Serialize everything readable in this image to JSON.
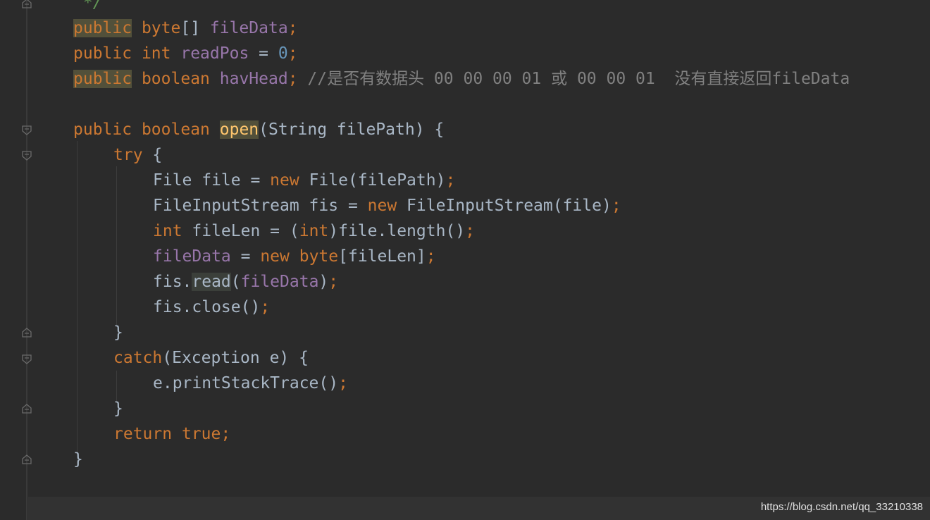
{
  "editor": {
    "lines": [
      {
        "tokens": [
          {
            "t": " */",
            "c": "doc"
          }
        ]
      },
      {
        "tokens": [
          {
            "t": "public",
            "c": "kw hl-kw"
          },
          {
            "t": " ",
            "c": "plain"
          },
          {
            "t": "byte",
            "c": "kw"
          },
          {
            "t": "[] ",
            "c": "plain"
          },
          {
            "t": "fileData",
            "c": "fld"
          },
          {
            "t": ";",
            "c": "semi"
          }
        ]
      },
      {
        "tokens": [
          {
            "t": "public",
            "c": "kw"
          },
          {
            "t": " ",
            "c": "plain"
          },
          {
            "t": "int",
            "c": "kw"
          },
          {
            "t": " ",
            "c": "plain"
          },
          {
            "t": "readPos",
            "c": "fld"
          },
          {
            "t": " = ",
            "c": "plain"
          },
          {
            "t": "0",
            "c": "num"
          },
          {
            "t": ";",
            "c": "semi"
          }
        ]
      },
      {
        "tokens": [
          {
            "t": "public",
            "c": "kw hl-kw"
          },
          {
            "t": " ",
            "c": "plain"
          },
          {
            "t": "boolean",
            "c": "kw"
          },
          {
            "t": " ",
            "c": "plain"
          },
          {
            "t": "havHead",
            "c": "fld"
          },
          {
            "t": "; ",
            "c": "semi"
          },
          {
            "t": "//是否有数据头 00 00 00 01 或 00 00 01  没有直接返回fileData",
            "c": "cmt"
          }
        ]
      },
      {
        "tokens": []
      },
      {
        "tokens": [
          {
            "t": "public",
            "c": "kw"
          },
          {
            "t": " ",
            "c": "plain"
          },
          {
            "t": "boolean",
            "c": "kw"
          },
          {
            "t": " ",
            "c": "plain"
          },
          {
            "t": "open",
            "c": "hl-yellow"
          },
          {
            "t": "(String filePath) {",
            "c": "plain"
          }
        ]
      },
      {
        "tokens": [
          {
            "t": "try",
            "c": "kw"
          },
          {
            "t": " {",
            "c": "plain"
          }
        ]
      },
      {
        "tokens": [
          {
            "t": "File file = ",
            "c": "plain"
          },
          {
            "t": "new",
            "c": "kw"
          },
          {
            "t": " File(filePath)",
            "c": "plain"
          },
          {
            "t": ";",
            "c": "semi"
          }
        ]
      },
      {
        "tokens": [
          {
            "t": "FileInputStream fis = ",
            "c": "plain"
          },
          {
            "t": "new",
            "c": "kw"
          },
          {
            "t": " FileInputStream(file)",
            "c": "plain"
          },
          {
            "t": ";",
            "c": "semi"
          }
        ]
      },
      {
        "tokens": [
          {
            "t": "int",
            "c": "kw"
          },
          {
            "t": " fileLen = (",
            "c": "plain"
          },
          {
            "t": "int",
            "c": "kw"
          },
          {
            "t": ")file.length()",
            "c": "plain"
          },
          {
            "t": ";",
            "c": "semi"
          }
        ]
      },
      {
        "tokens": [
          {
            "t": "fileData",
            "c": "fld"
          },
          {
            "t": " = ",
            "c": "plain"
          },
          {
            "t": "new",
            "c": "kw"
          },
          {
            "t": " ",
            "c": "plain"
          },
          {
            "t": "byte",
            "c": "kw"
          },
          {
            "t": "[fileLen]",
            "c": "plain"
          },
          {
            "t": ";",
            "c": "semi"
          }
        ]
      },
      {
        "tokens": [
          {
            "t": "fis.",
            "c": "plain"
          },
          {
            "t": "read",
            "c": "plain hl-read"
          },
          {
            "t": "(",
            "c": "plain"
          },
          {
            "t": "fileData",
            "c": "fld"
          },
          {
            "t": ")",
            "c": "plain"
          },
          {
            "t": ";",
            "c": "semi"
          }
        ]
      },
      {
        "tokens": [
          {
            "t": "fis.close()",
            "c": "plain"
          },
          {
            "t": ";",
            "c": "semi"
          }
        ]
      },
      {
        "tokens": [
          {
            "t": "}",
            "c": "plain"
          }
        ]
      },
      {
        "tokens": [
          {
            "t": "catch",
            "c": "kw"
          },
          {
            "t": "(Exception e) {",
            "c": "plain"
          }
        ]
      },
      {
        "tokens": [
          {
            "t": "e.printStackTrace()",
            "c": "plain"
          },
          {
            "t": ";",
            "c": "semi"
          }
        ]
      },
      {
        "tokens": [
          {
            "t": "}",
            "c": "plain"
          }
        ]
      },
      {
        "tokens": [
          {
            "t": "return",
            "c": "kw"
          },
          {
            "t": " ",
            "c": "plain"
          },
          {
            "t": "true",
            "c": "kw"
          },
          {
            "t": ";",
            "c": "semi"
          }
        ]
      },
      {
        "tokens": [
          {
            "t": "}",
            "c": "plain"
          }
        ]
      }
    ]
  },
  "watermark": "https://blog.csdn.net/qq_33210338",
  "colors": {
    "background": "#2b2b2b",
    "keyword": "#cc7832",
    "field": "#9876aa",
    "number": "#6897bb",
    "comment": "#808080",
    "doc_comment": "#629755",
    "text": "#a9b7c6",
    "method_highlight": "#ffc66d"
  }
}
